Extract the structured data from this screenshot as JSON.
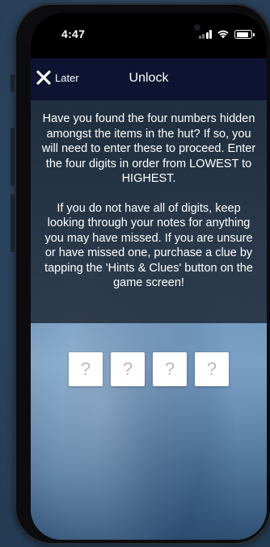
{
  "status_bar": {
    "time": "4:47"
  },
  "nav": {
    "later_label": "Later",
    "title": "Unlock"
  },
  "instructions": {
    "paragraph_1": "Have you found the four numbers hidden amongst the items in the hut? If so, you will need to enter these to proceed. Enter the four digits in order from LOWEST to HIGHEST.",
    "paragraph_2": "If you do not have all of digits, keep looking through your notes for anything you may have missed. If you are unsure or have missed one, purchase a clue by tapping the 'Hints & Clues' button on the game screen!"
  },
  "code_inputs": {
    "digit_1_placeholder": "?",
    "digit_2_placeholder": "?",
    "digit_3_placeholder": "?",
    "digit_4_placeholder": "?"
  },
  "icons": {
    "close": "close-icon",
    "signal": "cellular-signal-icon",
    "wifi": "wifi-icon",
    "battery": "battery-icon"
  },
  "colors": {
    "nav_background": "#0d1330",
    "instructions_overlay": "#19232f",
    "text": "#ffffff",
    "placeholder": "#b9b9b9"
  },
  "battery_level": 0.85
}
